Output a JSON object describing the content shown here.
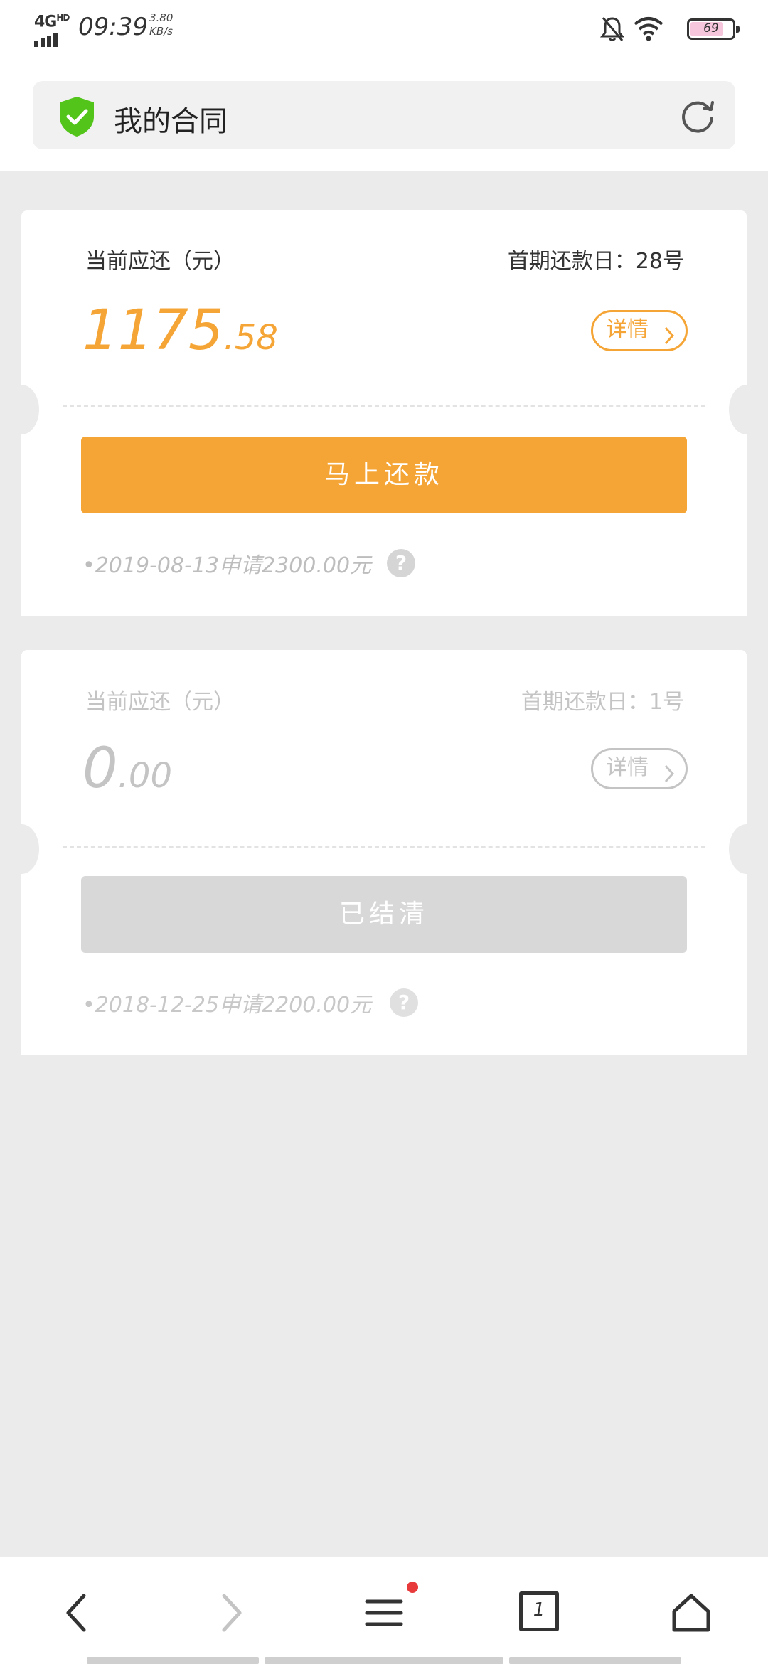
{
  "status_bar": {
    "network": "4G",
    "network_tag": "HD",
    "time": "09:39",
    "speed_value": "3.80",
    "speed_unit": "KB/s",
    "battery_percent": "69",
    "icons": [
      "mute-icon",
      "wifi-icon",
      "battery-icon"
    ]
  },
  "header": {
    "title": "我的合同",
    "shield_color": "#52c41a"
  },
  "contracts": [
    {
      "due_label": "当前应还（元）",
      "first_due_label": "首期还款日：28号",
      "amount_int": "1175",
      "amount_dec": ".58",
      "detail_label": "详情",
      "action_label": "马上还款",
      "apply_note": "•2019-08-13申请2300.00元",
      "help_glyph": "?",
      "status": "active",
      "accent_color": "#f5a535"
    },
    {
      "due_label": "当前应还（元）",
      "first_due_label": "首期还款日：1号",
      "amount_int": "0",
      "amount_dec": ".00",
      "detail_label": "详情",
      "action_label": "已结清",
      "apply_note": "•2018-12-25申请2200.00元",
      "help_glyph": "?",
      "status": "settled",
      "accent_color": "#c4c4c4"
    }
  ],
  "bottom_nav": {
    "items": [
      "back-icon",
      "forward-icon",
      "menu-icon",
      "tabs-icon",
      "home-icon"
    ],
    "tabs_count": "1",
    "badge_color": "#e83a3a"
  }
}
